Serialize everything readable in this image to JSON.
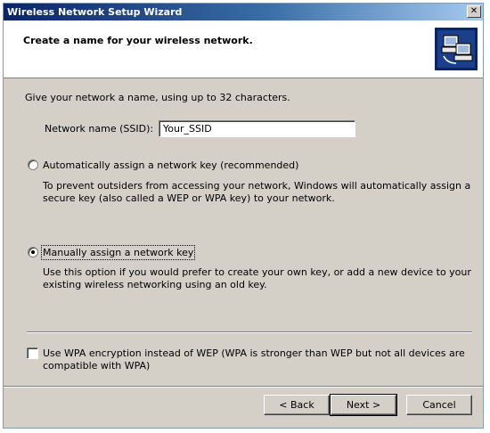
{
  "window": {
    "title": "Wireless Network Setup Wizard",
    "close_label": "✕"
  },
  "header": {
    "title": "Create a name for your wireless network.",
    "icon": "network-computers-icon"
  },
  "body": {
    "intro": "Give your network a name, using up to 32 characters.",
    "ssid_label": "Network name (SSID):",
    "ssid_value": "Your_SSID",
    "auto_option": {
      "label": "Automatically assign a network key (recommended)",
      "selected": false,
      "desc_line1": "To prevent outsiders from accessing your network, Windows will automatically assign a",
      "desc_line2": "secure key (also called a WEP or WPA key) to your network."
    },
    "manual_option": {
      "label": "Manually assign a network key",
      "selected": true,
      "desc_line1": "Use this option if you would prefer to create your own key, or add a new device to your",
      "desc_line2": "existing wireless networking using an old key."
    },
    "wpa_checkbox": {
      "label_line1": "Use WPA encryption instead of WEP (WPA is stronger than WEP but not all devices are",
      "label_line2": "compatible with WPA)",
      "checked": false
    }
  },
  "buttons": {
    "back": "< Back",
    "next": "Next >",
    "cancel": "Cancel"
  }
}
